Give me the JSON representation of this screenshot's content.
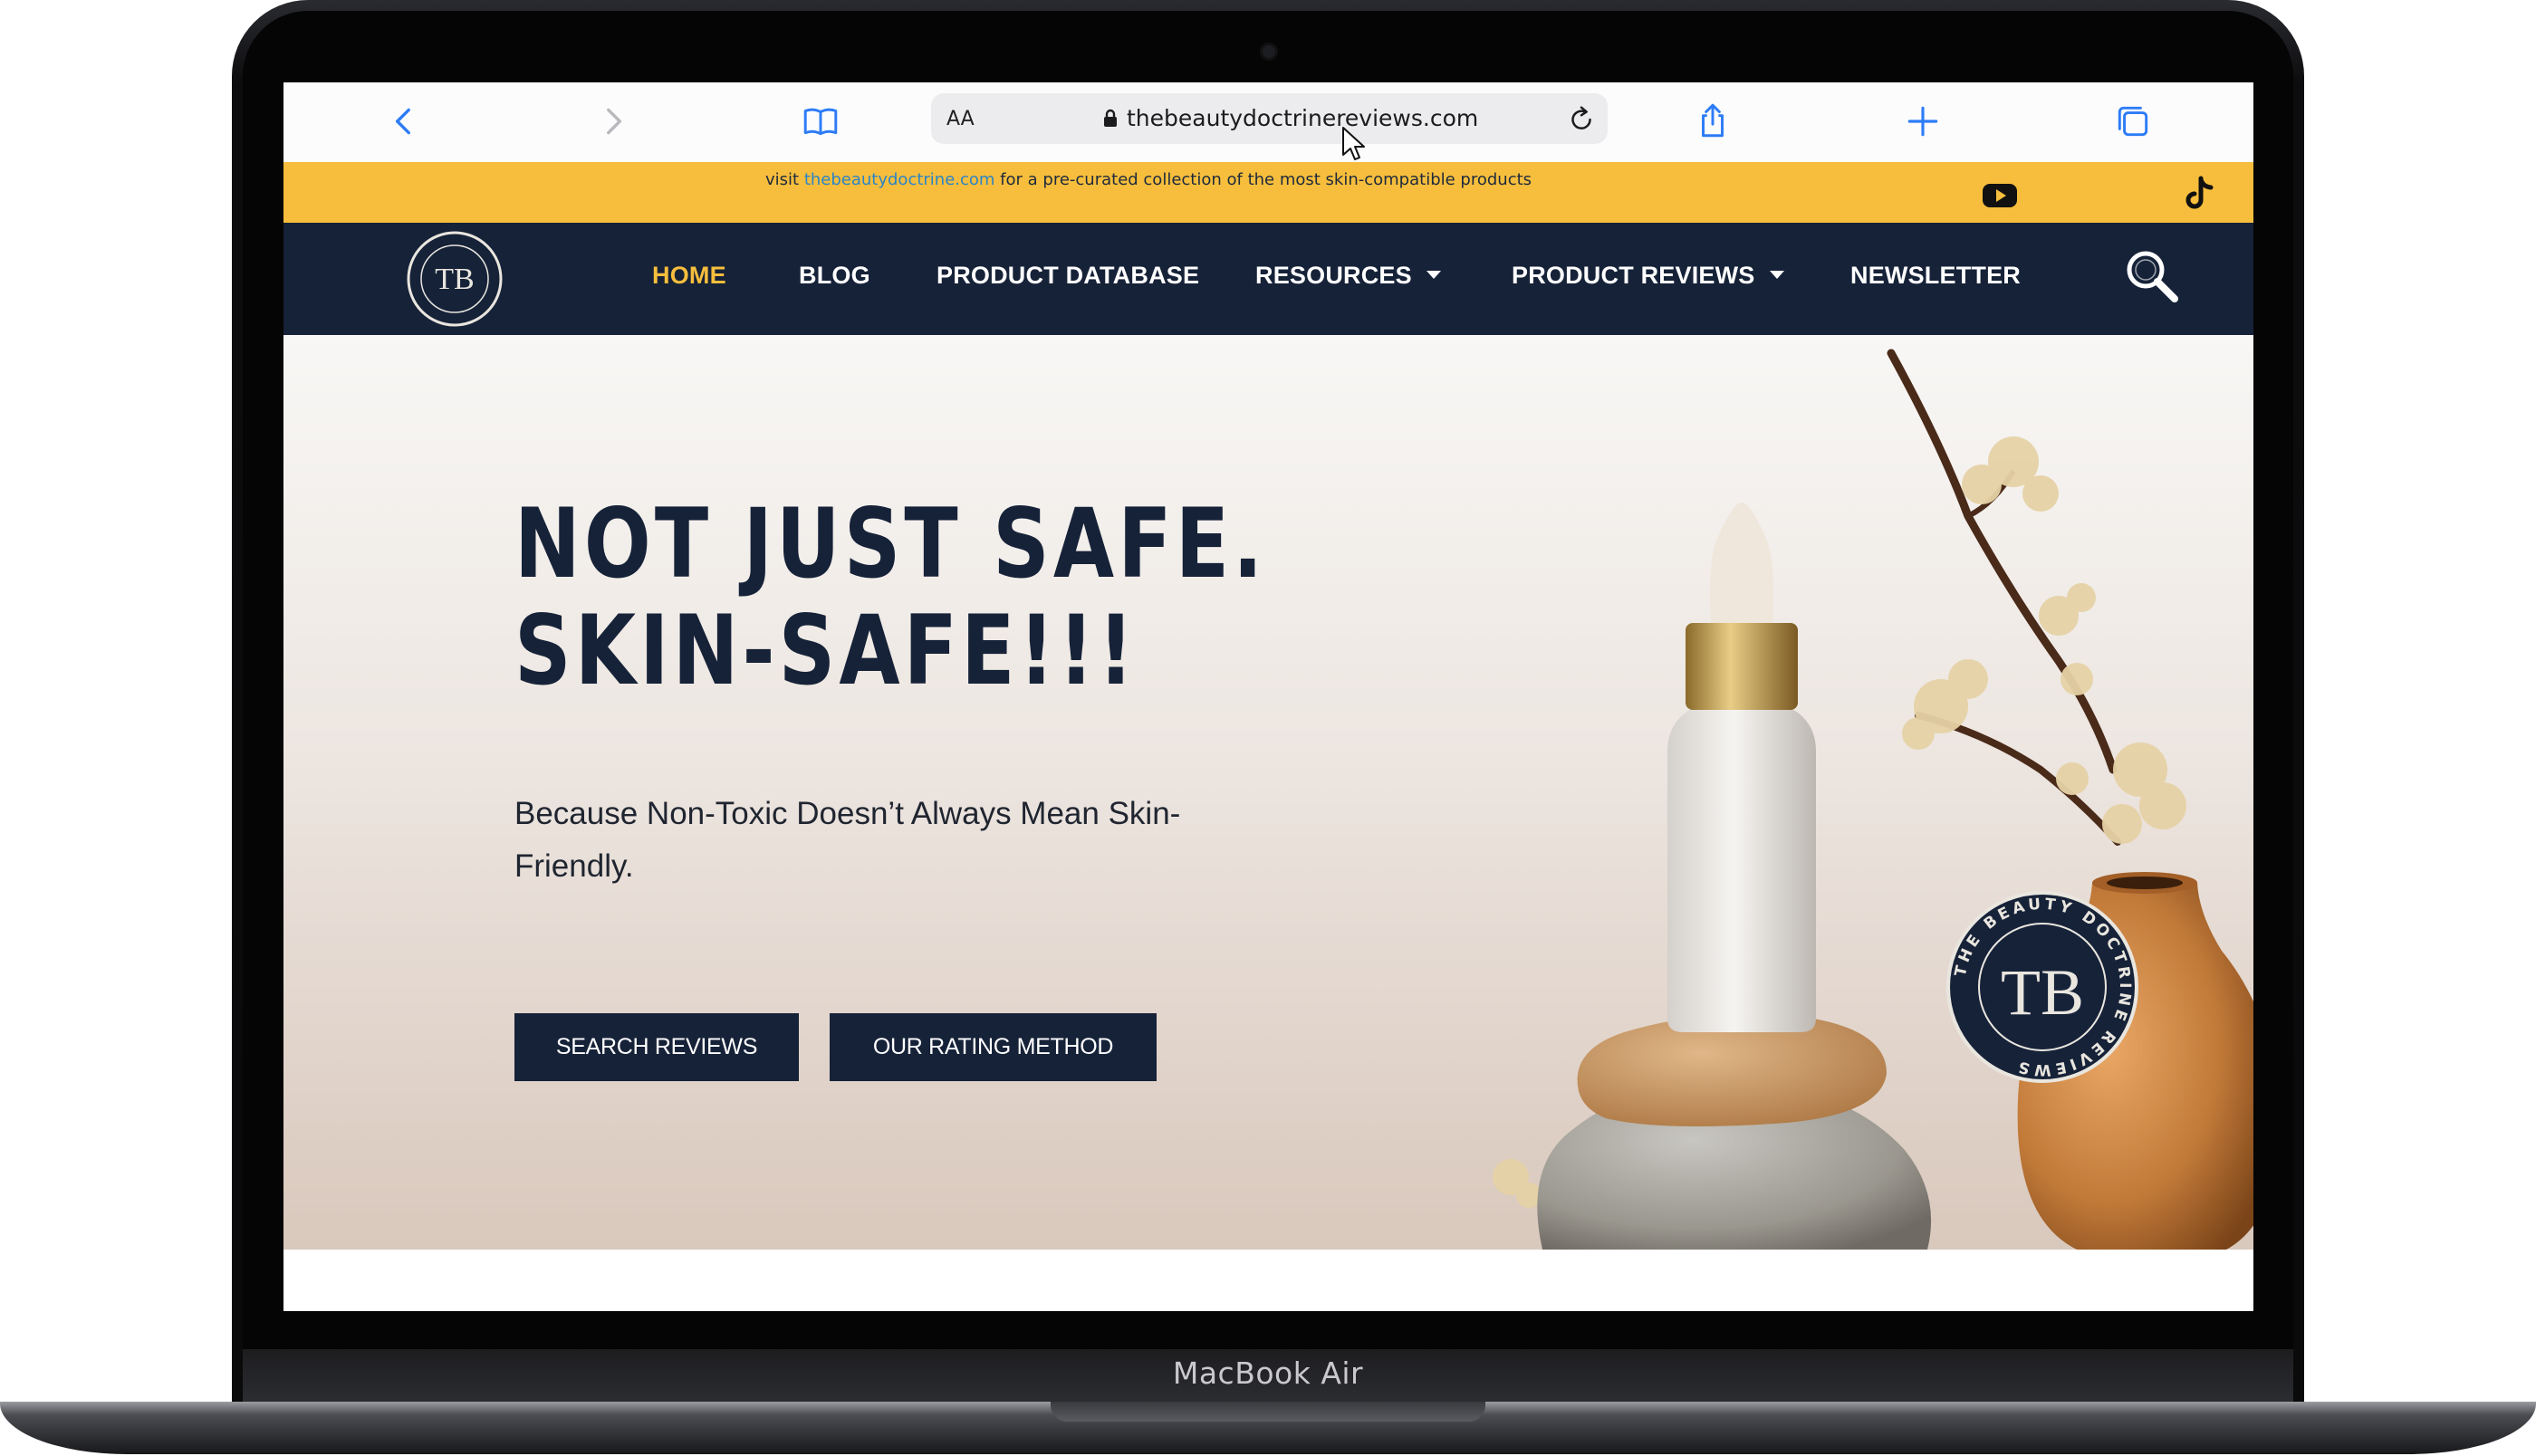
{
  "device": {
    "label": "MacBook Air"
  },
  "browser": {
    "url": "thebeautydoctrinereviews.com",
    "text_size_label": "AA",
    "icons": [
      "back-icon",
      "forward-icon",
      "bookmarks-icon",
      "lock-icon",
      "reload-icon",
      "share-icon",
      "new-tab-icon",
      "tabs-icon"
    ]
  },
  "promo": {
    "prefix": "visit ",
    "link": "thebeautydoctrine.com",
    "suffix": " for a pre-curated collection of the most skin-compatible products",
    "social": [
      "youtube-icon",
      "tiktok-icon"
    ]
  },
  "nav": {
    "items": [
      {
        "label": "HOME",
        "active": true
      },
      {
        "label": "BLOG"
      },
      {
        "label": "PRODUCT DATABASE"
      },
      {
        "label": "RESOURCES",
        "dropdown": true
      },
      {
        "label": "PRODUCT REVIEWS",
        "dropdown": true
      },
      {
        "label": "NEWSLETTER"
      }
    ],
    "search_icon": "search-icon"
  },
  "logo": {
    "monogram": "TB",
    "ring_text": "THE BEAUTY DOCTRINE REVIEWS"
  },
  "hero": {
    "title_line1": "NOT JUST SAFE.",
    "title_line2": "SKIN-SAFE!!!",
    "subtitle": "Because Non-Toxic Doesn’t Always Mean Skin-Friendly.",
    "buttons": [
      "SEARCH REVIEWS",
      "OUR RATING METHOD"
    ]
  },
  "colors": {
    "navy": "#162238",
    "gold": "#f6be3c",
    "link_blue": "#2b84c6"
  }
}
